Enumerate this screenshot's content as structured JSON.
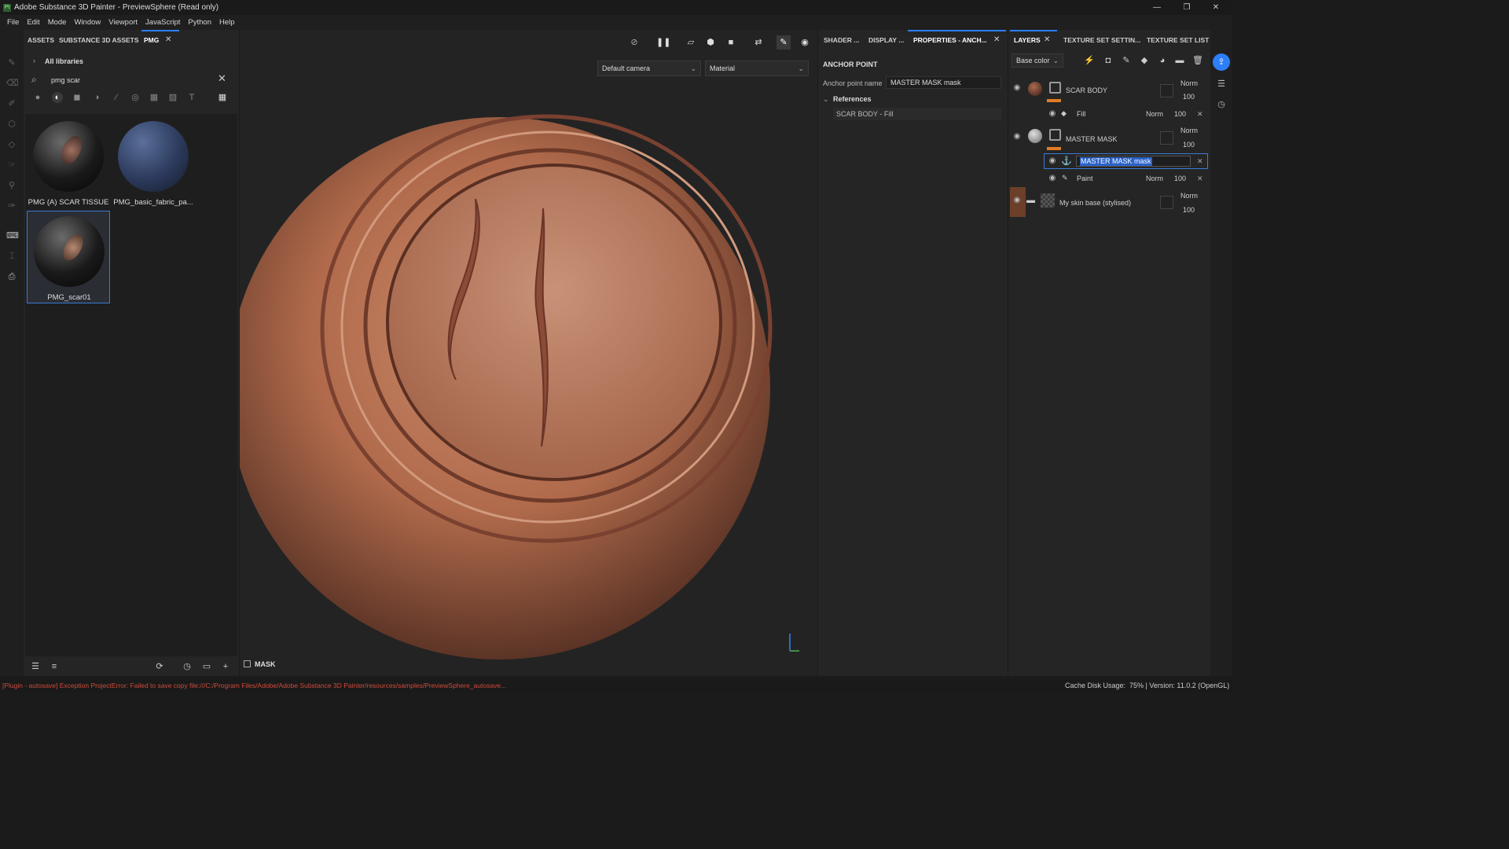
{
  "window": {
    "title": "Adobe Substance 3D Painter - PreviewSphere (Read only)",
    "logo": "Pt",
    "controls": [
      "—",
      "❐",
      "✕"
    ]
  },
  "menu": [
    "File",
    "Edit",
    "Mode",
    "Window",
    "Viewport",
    "JavaScript",
    "Python",
    "Help"
  ],
  "assets_panel": {
    "tabs": [
      "ASSETS",
      "SUBSTANCE 3D ASSETS",
      "PMG"
    ],
    "close_glyph": "✕",
    "library_label": "All libraries",
    "search_value": "pmg scar",
    "items": [
      {
        "label": "PMG (A) SCAR TISSUE"
      },
      {
        "label": "PMG_basic_fabric_pa..."
      },
      {
        "label": "PMG_scar01"
      }
    ]
  },
  "viewport": {
    "camera_select": "Default camera",
    "mode_select": "Material",
    "mask_label": "MASK"
  },
  "properties_panel": {
    "tabs": [
      "SHADER ...",
      "DISPLAY ...",
      "PROPERTIES - ANCH..."
    ],
    "section_title": "ANCHOR POINT",
    "field_label": "Anchor point name",
    "field_value": "MASTER MASK mask",
    "references_label": "References",
    "reference_item": "SCAR BODY - Fill"
  },
  "layers_panel": {
    "tabs": [
      "LAYERS",
      "TEXTURE SET SETTIN...",
      "TEXTURE SET LIST"
    ],
    "channel_select": "Base color",
    "layers": [
      {
        "name": "SCAR BODY",
        "blend": "Norm",
        "opacity": "100"
      },
      {
        "name": "Fill",
        "blend": "Norm",
        "opacity": "100"
      },
      {
        "name": "MASTER MASK",
        "blend": "Norm",
        "opacity": "100"
      },
      {
        "name": "MASTER MASK mask"
      },
      {
        "name": "Paint",
        "blend": "Norm",
        "opacity": "100"
      },
      {
        "name": "My skin base (stylised)",
        "blend": "Norm",
        "opacity": "100"
      }
    ]
  },
  "status": {
    "error": "[Plugin - autosave] Exception ProjectError: Failed to save copy file:///C:/Program Files/Adobe/Adobe Substance 3D Painter/resources/samples/PreviewSphere_autosave...",
    "cache": "Cache Disk Usage:",
    "info": "75% | Version: 11.0.2 (OpenGL)"
  },
  "colors": {
    "accent": "#2d7ff9",
    "layer_color_tag": "#e07b26",
    "skin": "#b36e4f",
    "error_text": "#d04a3a"
  }
}
